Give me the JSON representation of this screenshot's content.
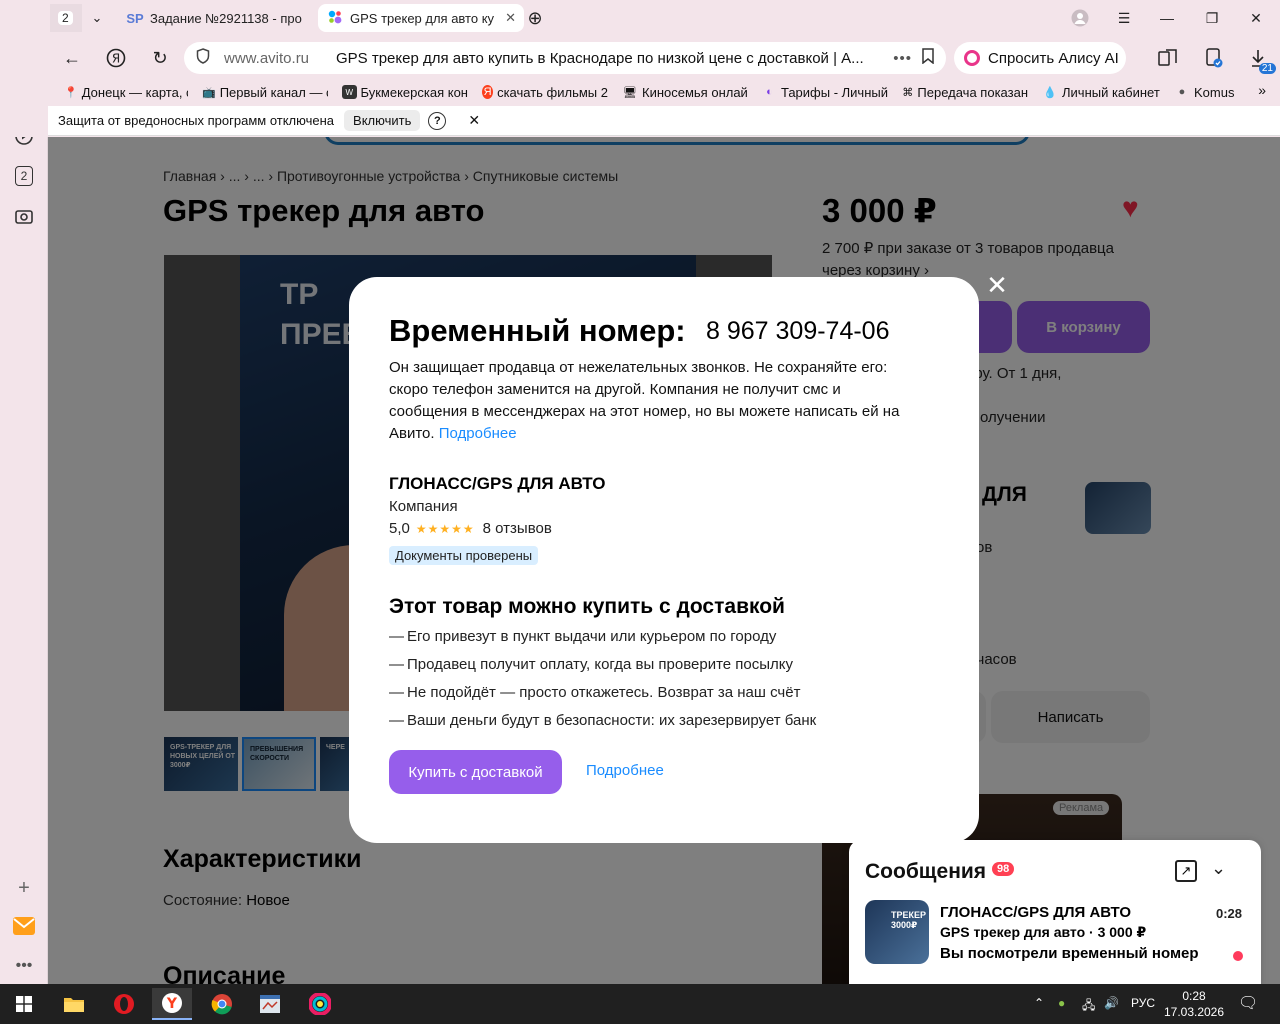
{
  "browser": {
    "tab_count": "2",
    "tabs": [
      {
        "favicon": "SP",
        "label": "Задание №2921138 - про"
      },
      {
        "favicon": "avito-icon",
        "label": "GPS трекер для авто ку"
      }
    ],
    "address": {
      "domain": "www.avito.ru",
      "title": "GPS трекер для авто купить в Краснодаре по низкой цене с доставкой | А...",
      "dots": "•••"
    },
    "alice_label": "Спросить Алису AI",
    "downloads_badge": "21",
    "bookmarks": [
      "Донецк — карта, с",
      "Первый канал — с",
      "Букмекерская кон",
      "скачать фильмы 2",
      "Киносемья онлай",
      "Тарифы - Личный",
      "Передача показан",
      "Личный кабинет",
      "Komus"
    ],
    "infobar": {
      "message": "Защита от вредоносных программ отключена",
      "enable_label": "Включить",
      "help": "?"
    },
    "sidebar_tab_badge": "2"
  },
  "page": {
    "breadcrumbs": "Главная › ... › ... › Противоугонные устройства › Спутниковые системы",
    "title": "GPS трекер для авто",
    "gallery_text": "ТР\nПРЕВ",
    "thumb_labels": [
      "GPS-ТРЕКЕР ДЛЯ НОВЫХ ЦЕЛЕЙ ОТ 3000₽",
      "ПРЕВЫШЕНИЯ СКОРОСТИ",
      "ЧЕРЕ"
    ],
    "price": "3 000 ₽",
    "bulk_offer": "2 700 ₽ при заказе от 3 товаров продавца через корзину ›",
    "cart_label": "В корзину",
    "delivery_fragment": "ару. От 1 дня,",
    "receipt_fragment": "олучении",
    "seller_fragment": "ДЛЯ",
    "reviews_fragment": "ов",
    "hours_fragment": "о часов",
    "write_label": "Написать",
    "ad_label": "Реклама",
    "characteristics_heading": "Характеристики",
    "condition_label": "Состояние:",
    "condition_value": "Новое",
    "description_heading": "Описание"
  },
  "modal": {
    "title": "Временный номер:",
    "phone": "8 967 309-74-06",
    "warning": "Он защищает продавца от нежелательных звонков. Не сохраняйте его: скоро телефон заменится на другой. Компания не получит смс и сообщения в мессенджерах на этот номер, но вы можете написать ей на Авито.",
    "warning_link": "Подробнее",
    "seller_name": "ГЛОНАСС/GPS ДЛЯ АВТО",
    "seller_type": "Компания",
    "rating": "5,0",
    "stars": "★★★★★",
    "reviews": "8 отзывов",
    "verified": "Документы проверены",
    "delivery_heading": "Этот товар можно купить с доставкой",
    "delivery_points": [
      "Его привезут в пункт выдачи или курьером по городу",
      "Продавец получит оплату, когда вы проверите посылку",
      "Не подойдёт — просто откажетесь. Возврат за наш счёт",
      "Ваши деньги будут в безопасности: их зарезервирует банк"
    ],
    "dash": "—",
    "buy_button": "Купить с доставкой",
    "more_link": "Подробнее",
    "close": "✕"
  },
  "messages": {
    "heading": "Сообщения",
    "unread": "98",
    "chat": {
      "name": "ГЛОНАСС/GPS ДЛЯ АВТО",
      "time": "0:28",
      "item": "GPS трекер для авто · 3 000 ₽",
      "last": "Вы посмотрели временный номер",
      "avatar_text": "ТРЕКЕР 3000₽"
    }
  },
  "taskbar": {
    "language": "РУС",
    "time": "0:28",
    "date": "17.03.2026"
  },
  "colors": {
    "avito_purple": "#965eeb",
    "link_blue": "#1a8cff",
    "heart_red": "#ff2c4a",
    "badge_red": "#ff4053"
  }
}
